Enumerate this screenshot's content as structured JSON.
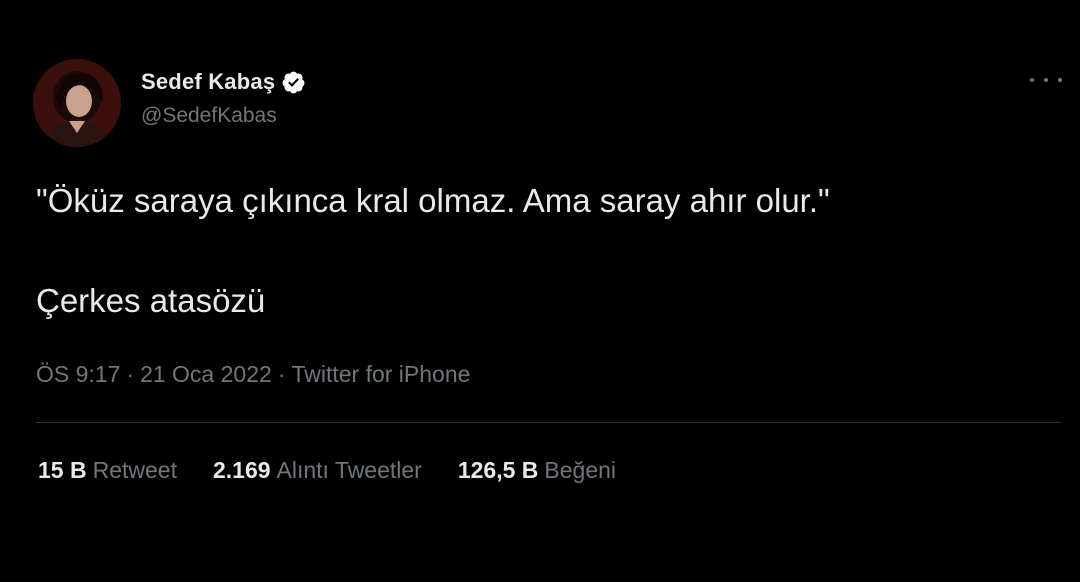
{
  "colors": {
    "background": "#000000",
    "primary_text": "#e7e9ea",
    "secondary_text": "#71767b",
    "verified": "#ffffff",
    "divider": "#2f3336"
  },
  "tweet": {
    "author": {
      "name": "Sedef Kabaş",
      "handle": "@SedefKabas",
      "verified_icon": "verified-badge-icon",
      "avatar_icon": "profile-photo"
    },
    "more_icon": "more-options-icon",
    "text_lines": [
      "\"Öküz saraya çıkınca kral olmaz. Ama saray ahır olur.\"",
      "Çerkes atasözü"
    ],
    "meta": {
      "time": "ÖS 9:17",
      "separator1": "·",
      "date": "21 Oca 2022",
      "separator2": "·",
      "source": "Twitter for iPhone"
    },
    "stats": [
      {
        "value": "15 B",
        "label": "Retweet"
      },
      {
        "value": "2.169",
        "label": "Alıntı Tweetler"
      },
      {
        "value": "126,5 B",
        "label": "Beğeni"
      }
    ]
  }
}
